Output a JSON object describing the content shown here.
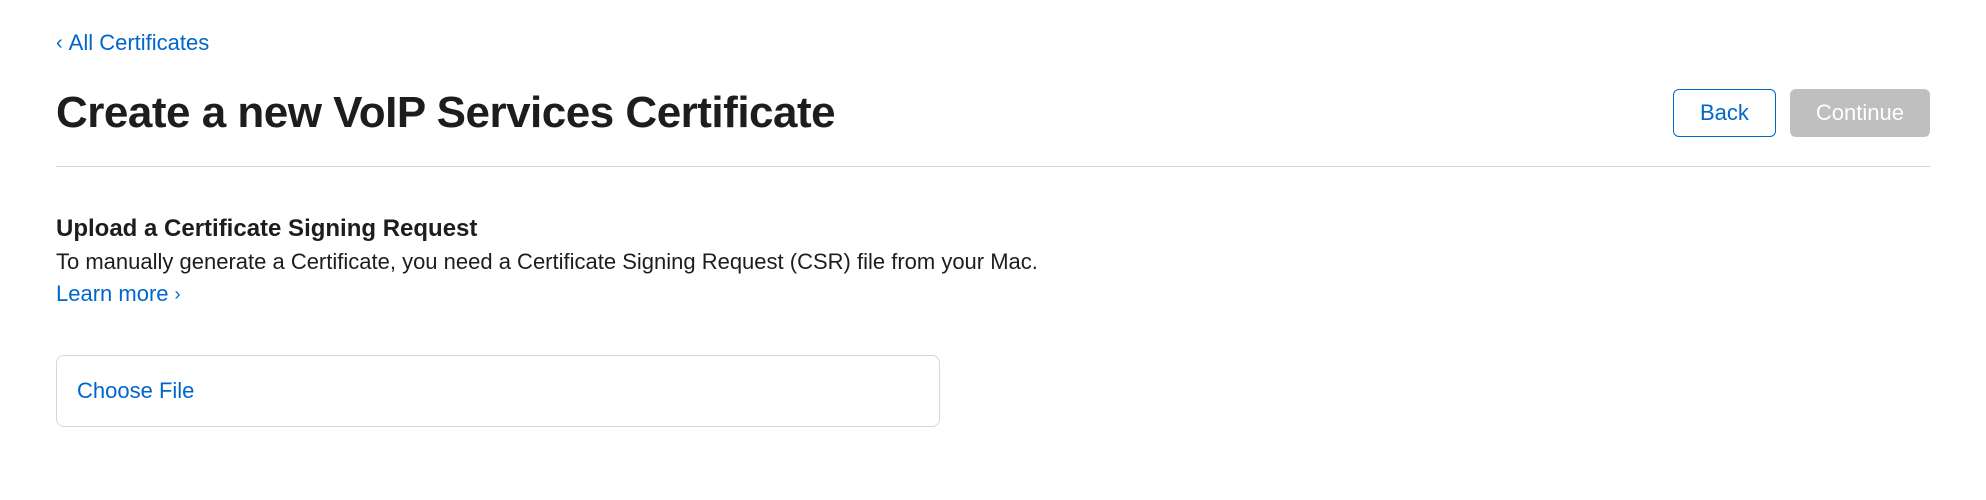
{
  "breadcrumb": {
    "label": "All Certificates"
  },
  "header": {
    "title": "Create a new VoIP Services Certificate",
    "back_label": "Back",
    "continue_label": "Continue"
  },
  "section": {
    "title": "Upload a Certificate Signing Request",
    "description": "To manually generate a Certificate, you need a Certificate Signing Request (CSR) file from your Mac.",
    "learn_more_label": "Learn more"
  },
  "file_upload": {
    "choose_file_label": "Choose File"
  }
}
